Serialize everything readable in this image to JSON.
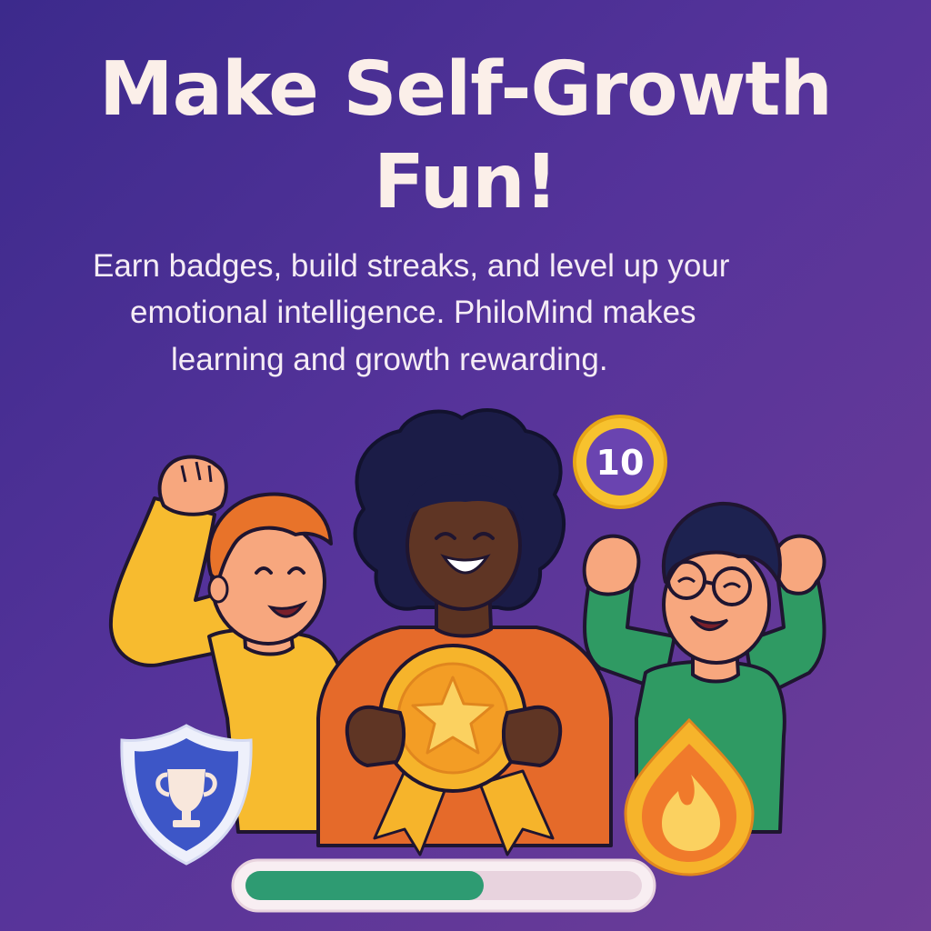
{
  "headline": {
    "line1": "Make Self-Growth",
    "line2": "Fun!"
  },
  "subtitle": {
    "line1": "Earn badges, build streaks, and level up your",
    "line2": "emotional intelligence. PhiloMind makes",
    "line3": "learning and growth rewarding."
  },
  "level_badge": {
    "value": "10"
  },
  "progress": {
    "fraction": 0.6
  },
  "colors": {
    "background_start": "#3c2a8c",
    "background_end": "#6e3d97",
    "headline": "#fbefe9",
    "progress_fill": "#2e9b72",
    "progress_track": "#e8d3de",
    "coin_gold": "#f6b42b",
    "shield_blue": "#3d56c7",
    "flame_orange": "#f07a2b"
  },
  "icons": [
    "trophy-icon",
    "star-medal-icon",
    "flame-icon",
    "level-coin-icon"
  ]
}
